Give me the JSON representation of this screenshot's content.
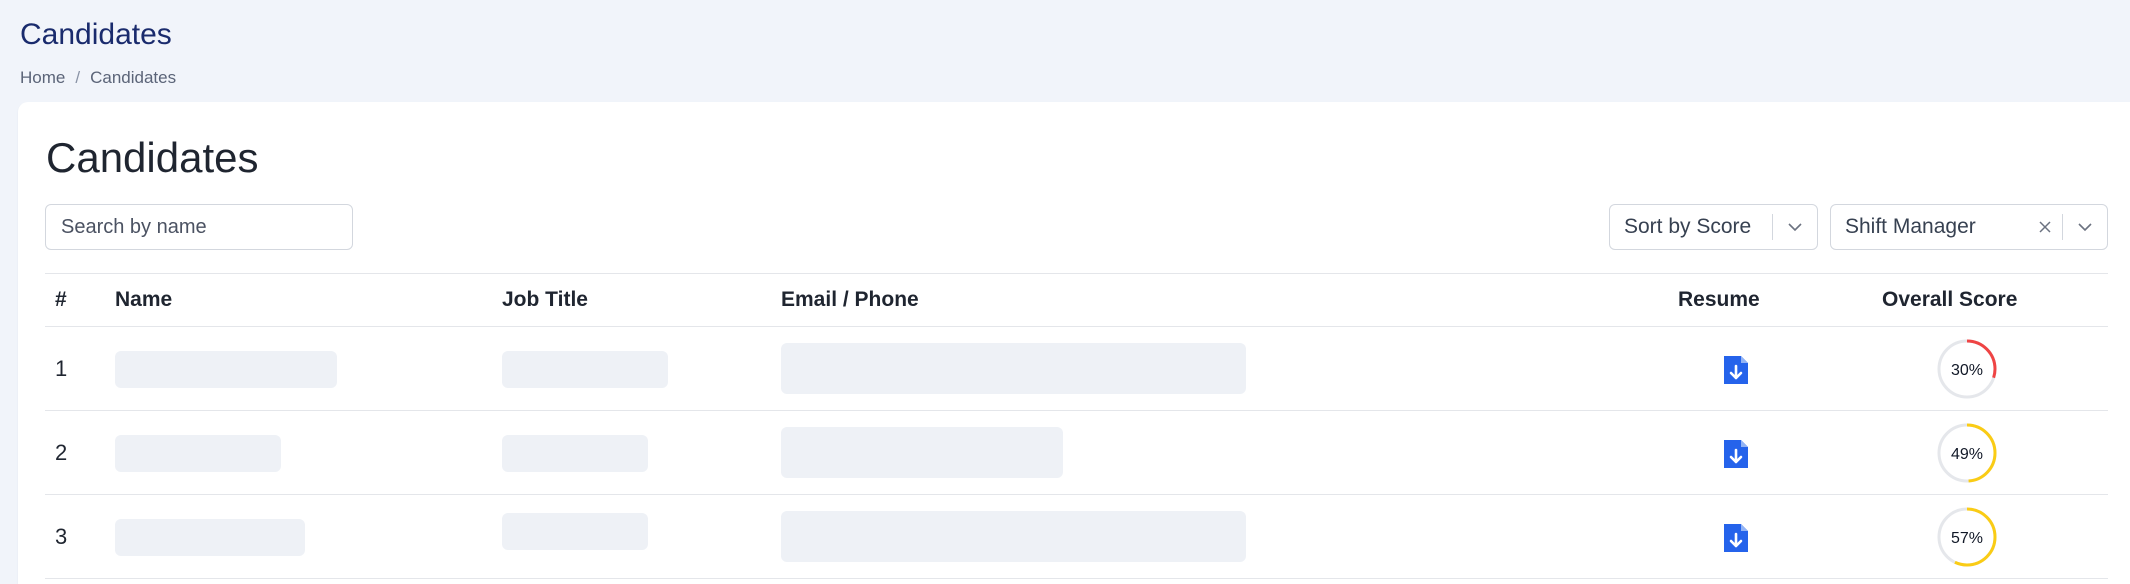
{
  "page": {
    "title": "Candidates"
  },
  "breadcrumb": {
    "home": "Home",
    "separator": "/",
    "current": "Candidates"
  },
  "card": {
    "title": "Candidates"
  },
  "search": {
    "placeholder": "Search by name",
    "value": ""
  },
  "sort_select": {
    "selected": "Sort by Score"
  },
  "job_select": {
    "selected": "Shift Manager"
  },
  "table": {
    "columns": [
      "#",
      "Name",
      "Job Title",
      "Email / Phone",
      "Resume",
      "Overall Score"
    ],
    "rows": [
      {
        "index": "1",
        "resume_icon": "file-download-icon",
        "score": 30,
        "score_label": "30%",
        "score_color": "#ef4444"
      },
      {
        "index": "2",
        "resume_icon": "file-download-icon",
        "score": 49,
        "score_label": "49%",
        "score_color": "#facc15"
      },
      {
        "index": "3",
        "resume_icon": "file-download-icon",
        "score": 57,
        "score_label": "57%",
        "score_color": "#facc15"
      }
    ]
  },
  "colors": {
    "accent": "#1a2b6d",
    "resume_icon": "#2563eb",
    "skeleton": "#eef1f6",
    "track": "#e5e7eb"
  }
}
